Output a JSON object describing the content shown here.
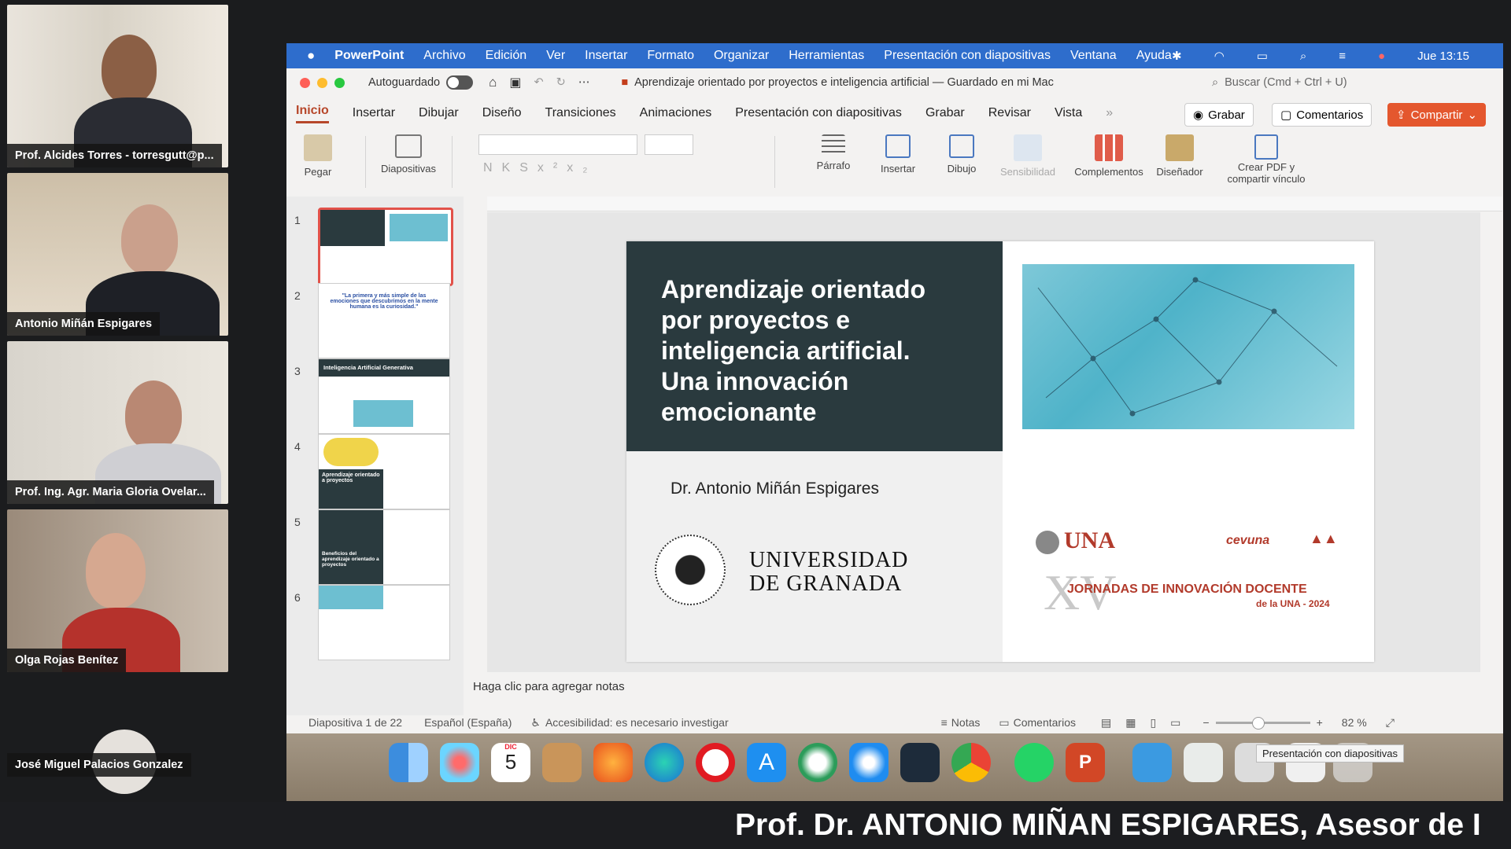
{
  "participants": [
    {
      "name": "Prof. Alcides Torres - torresgutt@p..."
    },
    {
      "name": "Antonio Miñán Espigares"
    },
    {
      "name": "Prof. Ing. Agr. Maria Gloria Ovelar..."
    },
    {
      "name": "Olga Rojas Benítez"
    },
    {
      "name": "José Miguel Palacios Gonzalez"
    }
  ],
  "menubar": {
    "app": "PowerPoint",
    "items": [
      "Archivo",
      "Edición",
      "Ver",
      "Insertar",
      "Formato",
      "Organizar",
      "Herramientas",
      "Presentación con diapositivas",
      "Ventana",
      "Ayuda"
    ],
    "clock": "Jue 13:15"
  },
  "titlebar": {
    "autosave": "Autoguardado",
    "document_title": "Aprendizaje orientado por proyectos e inteligencia artificial — Guardado en mi Mac",
    "search_placeholder": "Buscar (Cmd + Ctrl + U)"
  },
  "tabs": [
    "Inicio",
    "Insertar",
    "Dibujar",
    "Diseño",
    "Transiciones",
    "Animaciones",
    "Presentación con diapositivas",
    "Grabar",
    "Revisar",
    "Vista"
  ],
  "tab_buttons": {
    "record": "Grabar",
    "comments": "Comentarios",
    "share": "Compartir"
  },
  "ribbon": {
    "paste": "Pegar",
    "slides": "Diapositivas",
    "paragraph": "Párrafo",
    "insert": "Insertar",
    "drawing": "Dibujo",
    "sensitivity": "Sensibilidad",
    "addins": "Complementos",
    "designer": "Diseñador",
    "pdf_line1": "Crear PDF y",
    "pdf_line2": "compartir vínculo"
  },
  "thumbnails": [
    "1",
    "2",
    "3",
    "4",
    "5",
    "6"
  ],
  "thumb_texts": {
    "t2": "\"La primera y más simple de las emociones que descubrimos en la mente humana es la curiosidad.\"",
    "t3": "Inteligencia Artificial Generativa",
    "t4": "Aprendizaje orientado a proyectos",
    "t5": "Beneficios del aprendizaje orientado a proyectos"
  },
  "slide": {
    "title_lines": [
      "Aprendizaje orientado",
      "por proyectos e",
      "inteligencia artificial.",
      "Una innovación",
      "emocionante"
    ],
    "author": "Dr. Antonio Miñán Espigares",
    "university_line1": "UNIVERSIDAD",
    "university_line2": "DE GRANADA",
    "una": "UNA",
    "cevuna": "cevuna",
    "roman": "XV",
    "jornadas": "JORNADAS DE INNOVACIÓN DOCENTE",
    "jornadas_sub": "de la UNA - 2024"
  },
  "notes_placeholder": "Haga clic para agregar notas",
  "status": {
    "slide_counter": "Diapositiva 1 de 22",
    "language": "Español (España)",
    "accessibility": "Accesibilidad: es necesario investigar",
    "notes": "Notas",
    "comments": "Comentarios",
    "zoom": "82 %"
  },
  "dock": {
    "calendar_month": "DIC",
    "calendar_day": "5"
  },
  "tooltip": "Presentación con diapositivas",
  "caption": "Prof. Dr. ANTONIO MIÑAN ESPIGARES, Asesor de I",
  "colors": {
    "menubar": "#2e6dcc",
    "accent": "#b7472a",
    "share": "#e4572e",
    "slide_dark": "#2a3a3e"
  }
}
